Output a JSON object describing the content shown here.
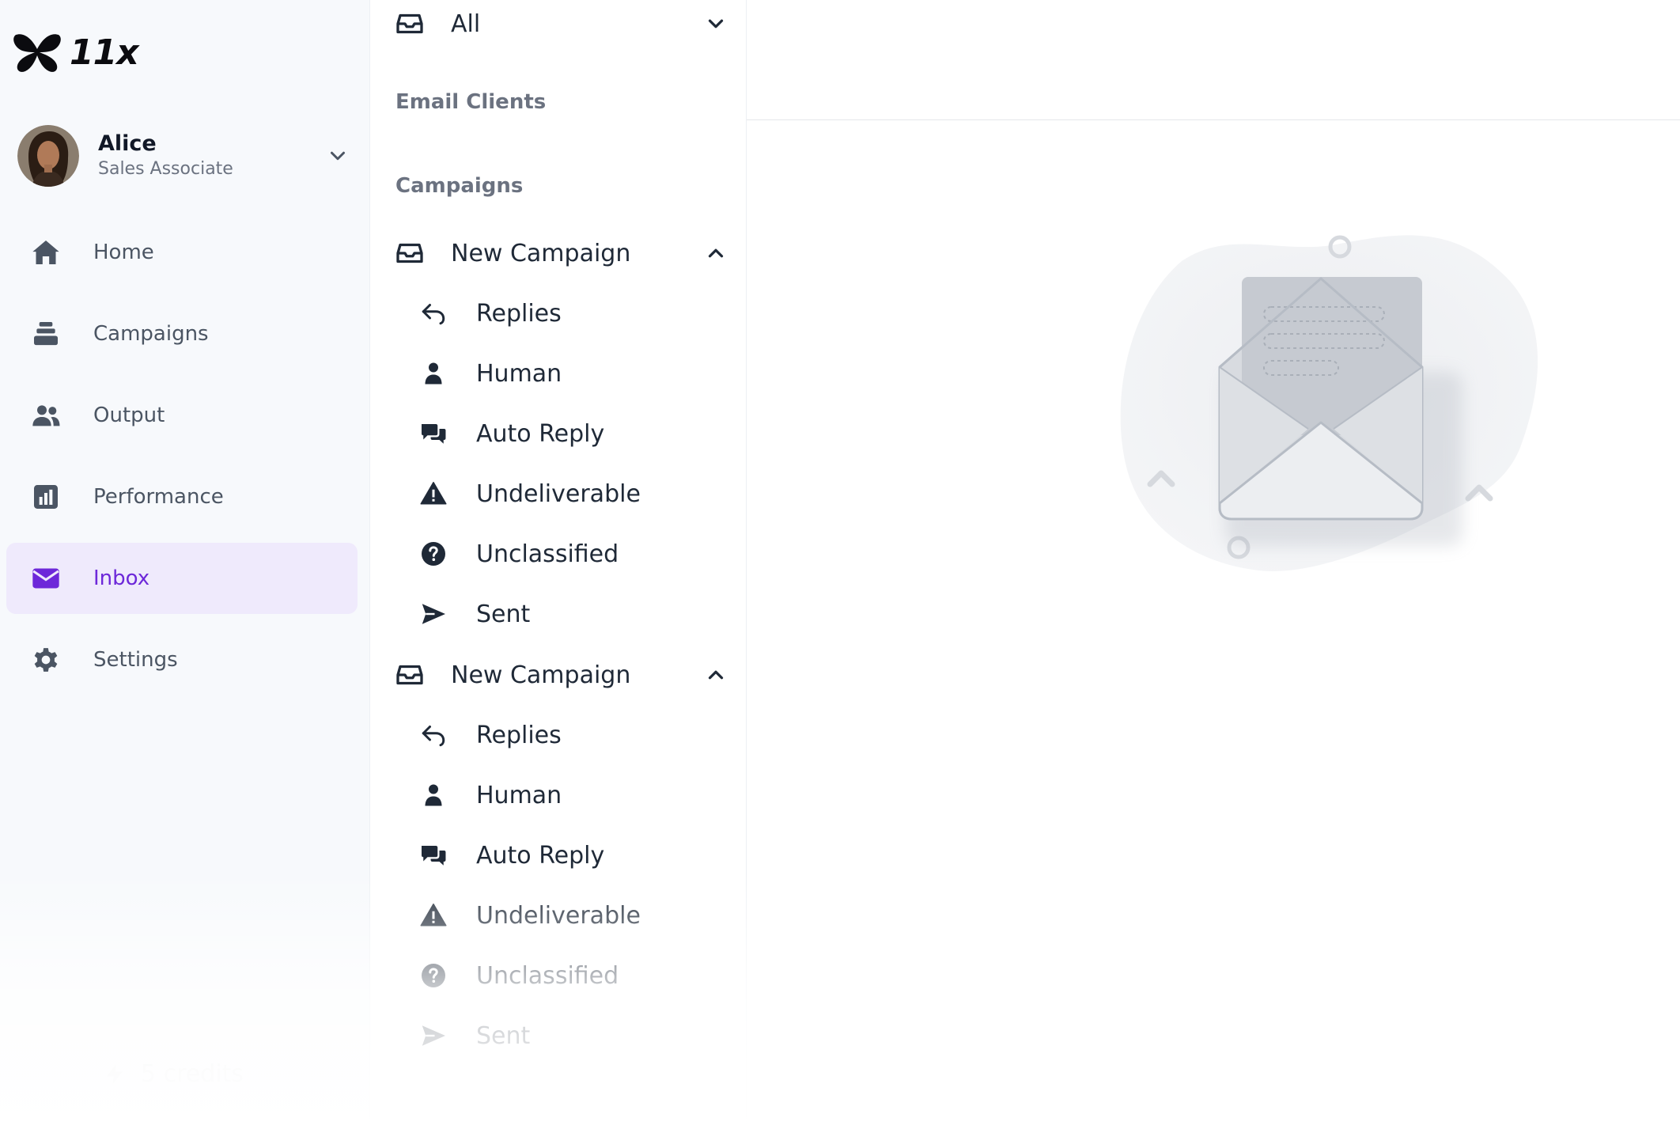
{
  "app": {
    "logo_text": "11x"
  },
  "profile": {
    "name": "Alice",
    "role": "Sales Associate"
  },
  "nav": {
    "items": [
      {
        "label": "Home",
        "icon": "home-icon"
      },
      {
        "label": "Campaigns",
        "icon": "layers-icon"
      },
      {
        "label": "Output",
        "icon": "users-icon"
      },
      {
        "label": "Performance",
        "icon": "bar-chart-icon"
      },
      {
        "label": "Inbox",
        "icon": "mail-icon",
        "active": true
      },
      {
        "label": "Settings",
        "icon": "gear-icon"
      }
    ],
    "credits_label": "5 credits"
  },
  "folders": {
    "all_label": "All",
    "email_clients_label": "Email Clients",
    "campaigns_label": "Campaigns",
    "campaign_groups": [
      {
        "name": "New Campaign",
        "items": [
          {
            "label": "Replies",
            "icon": "reply-icon"
          },
          {
            "label": "Human",
            "icon": "person-icon"
          },
          {
            "label": "Auto Reply",
            "icon": "chat-bubbles-icon"
          },
          {
            "label": "Undeliverable",
            "icon": "warning-icon"
          },
          {
            "label": "Unclassified",
            "icon": "question-icon"
          },
          {
            "label": "Sent",
            "icon": "send-icon"
          }
        ]
      },
      {
        "name": "New Campaign",
        "items": [
          {
            "label": "Replies",
            "icon": "reply-icon"
          },
          {
            "label": "Human",
            "icon": "person-icon"
          },
          {
            "label": "Auto Reply",
            "icon": "chat-bubbles-icon"
          },
          {
            "label": "Undeliverable",
            "icon": "warning-icon"
          },
          {
            "label": "Unclassified",
            "icon": "question-icon"
          },
          {
            "label": "Sent",
            "icon": "send-icon"
          }
        ]
      }
    ]
  },
  "colors": {
    "accent": "#6d28d9",
    "active_bg": "#efeafc",
    "sidebar_bg": "#f7f9fc",
    "icon_dark": "#1f2937",
    "nav_icon": "#4b5563"
  }
}
